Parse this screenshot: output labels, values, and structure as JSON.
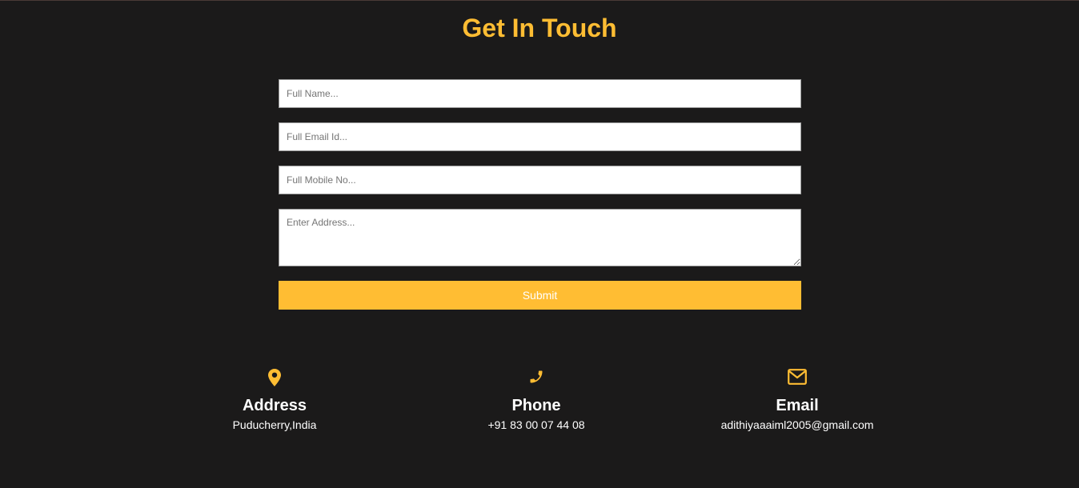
{
  "title": "Get In Touch",
  "form": {
    "name_placeholder": "Full Name...",
    "email_placeholder": "Full Email Id...",
    "mobile_placeholder": "Full Mobile No...",
    "address_placeholder": "Enter Address...",
    "submit_label": "Submit"
  },
  "contact": {
    "address": {
      "icon": "map-pin-icon",
      "label": "Address",
      "value": "Puducherry,India"
    },
    "phone": {
      "icon": "phone-icon",
      "label": "Phone",
      "value": "+91 83 00 07 44 08"
    },
    "email": {
      "icon": "envelope-icon",
      "label": "Email",
      "value": "adithiyaaaiml2005@gmail.com"
    }
  },
  "colors": {
    "background": "#1b1a1a",
    "accent": "#ffbd33",
    "text": "#ffffff"
  }
}
